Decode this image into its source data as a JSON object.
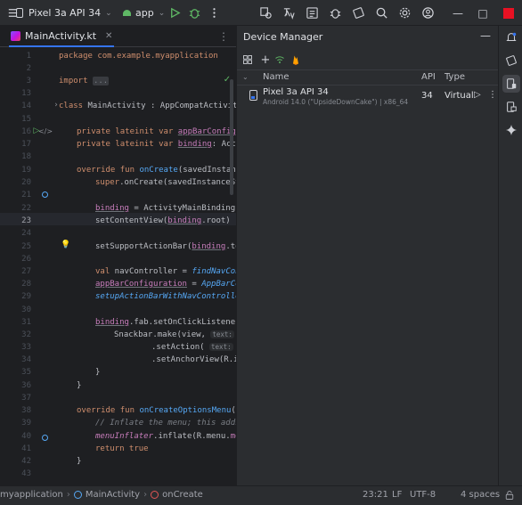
{
  "titlebar": {
    "device": "Pixel 3a API 34",
    "run_config": "app",
    "minimize": "—",
    "maximize": "□"
  },
  "editor": {
    "tab_label": "MainActivity.kt",
    "current_line": "23",
    "lines": [
      {
        "n": "1",
        "html_id": "l1"
      },
      {
        "n": "2"
      },
      {
        "n": "3",
        "html_id": "l3"
      },
      {
        "n": "13"
      },
      {
        "n": "14",
        "html_id": "l14"
      },
      {
        "n": "15"
      },
      {
        "n": "16",
        "html_id": "l16"
      },
      {
        "n": "17",
        "html_id": "l17"
      },
      {
        "n": "18"
      },
      {
        "n": "19",
        "html_id": "l19"
      },
      {
        "n": "20",
        "html_id": "l20"
      },
      {
        "n": "21"
      },
      {
        "n": "22",
        "html_id": "l22"
      },
      {
        "n": "23",
        "html_id": "l23"
      },
      {
        "n": "24"
      },
      {
        "n": "25",
        "html_id": "l25"
      },
      {
        "n": "26"
      },
      {
        "n": "27",
        "html_id": "l27"
      },
      {
        "n": "28",
        "html_id": "l28"
      },
      {
        "n": "29",
        "html_id": "l29"
      },
      {
        "n": "30"
      },
      {
        "n": "31",
        "html_id": "l31"
      },
      {
        "n": "32",
        "html_id": "l32"
      },
      {
        "n": "33",
        "html_id": "l33"
      },
      {
        "n": "34",
        "html_id": "l34"
      },
      {
        "n": "35",
        "html_id": "l35"
      },
      {
        "n": "36",
        "html_id": "l36"
      },
      {
        "n": "37"
      },
      {
        "n": "38",
        "html_id": "l38"
      },
      {
        "n": "39",
        "html_id": "l39"
      },
      {
        "n": "40",
        "html_id": "l40"
      },
      {
        "n": "41",
        "html_id": "l41"
      },
      {
        "n": "42",
        "html_id": "l42"
      },
      {
        "n": "43"
      }
    ],
    "code": {
      "package": "package com.example.myapplication",
      "import_kw": "import",
      "import_fold": "...",
      "class_decl_kw": "class",
      "class_decl_rest": " MainActivity : AppCompatActivity",
      "l16_kw": "private lateinit var",
      "l16_prop": "appBarConfigu",
      "l17_kw": "private lateinit var",
      "l17_prop": "binding",
      "l17_rest": ": Acti",
      "l19_kw": "override fun",
      "l19_fn": "onCreate",
      "l19_rest": "(savedInstanc",
      "l20_kw": "super",
      "l20_rest": ".onCreate(savedInstanceSt",
      "l22_prop": "binding",
      "l22_rest": " = ActivityMainBinding.",
      "l23_a": "setContentView(",
      "l23_prop": "binding",
      "l23_b": ".root)",
      "l25_a": "setSupportActionBar(",
      "l25_prop": "binding",
      "l25_b": ".to",
      "l27_kw": "val",
      "l27_a": " navController = ",
      "l27_fn": "findNavCon",
      "l28_prop": "appBarConfiguration",
      "l28_a": " = ",
      "l28_it": "AppBarCo",
      "l29_it": "setupActionBarWithNavControlle",
      "l31_prop": "binding",
      "l31_rest": ".fab.setOnClickListener",
      "l32_a": "Snackbar.make(view, ",
      "l32_hint": "text:",
      "l32_b": " \"",
      "l33_a": ".setAction( ",
      "l33_hint": "text:",
      "l33_b": " \"A",
      "l34": ".setAnchorView(R.i",
      "l35": "}",
      "l36": "}",
      "l38_kw": "override fun",
      "l38_fn": "onCreateOptionsMenu",
      "l38_rest": "(m",
      "l39": "// Inflate the menu; this adds",
      "l40_it": "menuInflater",
      "l40_a": ".inflate(R.menu.",
      "l40_prop": "me",
      "l41_kw": "return true",
      "l42": "}"
    }
  },
  "device_manager": {
    "title": "Device Manager",
    "minimize": "—",
    "headers": {
      "name": "Name",
      "api": "API",
      "type": "Type"
    },
    "devices": [
      {
        "name": "Pixel 3a API 34",
        "subtitle": "Android 14.0 (\"UpsideDownCake\") | x86_64",
        "api": "34",
        "type": "Virtual"
      }
    ]
  },
  "statusbar": {
    "project": "myapplication",
    "file": "MainActivity",
    "symbol": "onCreate",
    "position": "23:21",
    "line_sep": "LF",
    "encoding": "UTF-8",
    "indent": "4 spaces"
  },
  "colors": {
    "accent": "#3574f0",
    "keyword": "#cf8e6d",
    "function": "#56a8f5",
    "property": "#c77dbb",
    "run_green": "#5fb865"
  }
}
